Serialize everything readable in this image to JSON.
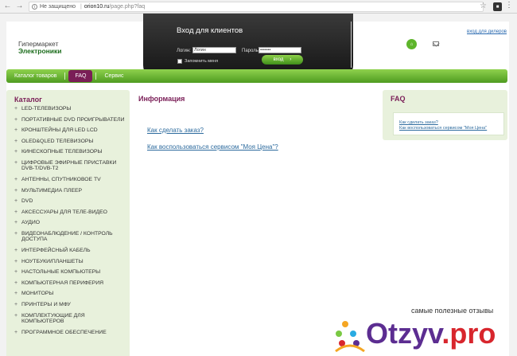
{
  "browser": {
    "secure_label": "Не защищено",
    "domain": "orion10.ru",
    "path": "/page.php?faq"
  },
  "header": {
    "logo_line1": "Гипермаркет",
    "logo_line2": "Электроники",
    "login_title": "Вход для клиентов",
    "login_label": "Логин:",
    "login_value": "Логин",
    "password_label": "Пароль:",
    "password_value": "•••••••",
    "remember_label": "Запомнить меня",
    "login_button": "вход",
    "dealers_link": "вход для дилеров"
  },
  "nav": {
    "items": [
      {
        "label": "Каталог товаров"
      },
      {
        "label": "FAQ"
      },
      {
        "label": "Сервис"
      }
    ]
  },
  "sidebar": {
    "title": "Каталог",
    "items": [
      "LED-ТЕЛЕВИЗОРЫ",
      "ПОРТАТИВНЫЕ DVD ПРОИГРЫВАТЕЛИ",
      "КРОНШТЕЙНЫ ДЛЯ LED LCD",
      "OLED&QLED ТЕЛЕВИЗОРЫ",
      "КИНЕСКОПНЫЕ ТЕЛЕВИЗОРЫ",
      "ЦИФРОВЫЕ ЭФИРНЫЕ ПРИСТАВКИ DVB-T/DVB-T2",
      "АНТЕННЫ, СПУТНИКОВОЕ TV",
      "МУЛЬТИМЕДИА ПЛЕЕР",
      "DVD",
      "АКСЕССУАРЫ ДЛЯ ТЕЛЕ-ВИДЕО",
      "АУДИО",
      "ВИДЕОНАБЛЮДЕНИЕ / КОНТРОЛЬ ДОСТУПА",
      "ИНТЕРФЕЙСНЫЙ КАБЕЛЬ",
      "НОУТБУКИ/ПЛАНШЕТЫ",
      "НАСТОЛЬНЫЕ КОМПЬЮТЕРЫ",
      "КОМПЬЮТЕРНАЯ ПЕРИФЕРИЯ",
      "МОНИТОРЫ",
      "ПРИНТЕРЫ И МФУ",
      "КОМПЛЕКТУЮЩИЕ ДЛЯ КОМПЬЮТЕРОВ",
      "ПРОГРАММНОЕ ОБЕСПЕЧЕНИЕ"
    ]
  },
  "main": {
    "title": "Информация",
    "links": [
      "Как сделать заказ?",
      "Как воспользоваться сервисом \"Моя Цена\"?"
    ]
  },
  "faq_box": {
    "title": "FAQ",
    "links": [
      "Как сделать заказ?",
      "Как воспользоваться сервисом \"Моя Цена\""
    ]
  },
  "watermark": {
    "tagline": "самые полезные отзывы",
    "brand_main": "Otzyv",
    "brand_dot": ".",
    "brand_tld": "pro"
  }
}
